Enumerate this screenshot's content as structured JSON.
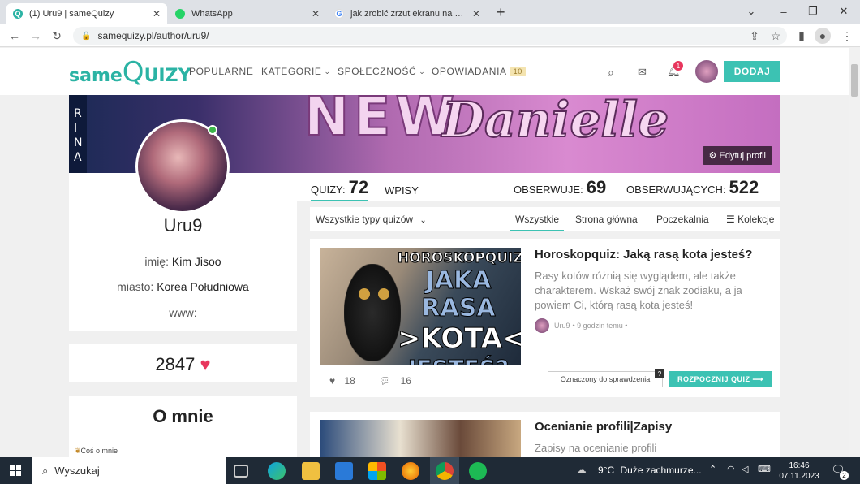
{
  "browser": {
    "tabs": [
      {
        "title": "(1) Uru9 | sameQuizy",
        "active": true,
        "icon": "samequizy-q-icon"
      },
      {
        "title": "WhatsApp",
        "active": false,
        "icon": "whatsapp-icon"
      },
      {
        "title": "jak zrobić zrzut ekranu na komp",
        "active": false,
        "icon": "google-g-icon"
      }
    ],
    "new_tab": "+",
    "url": "samequizy.pl/author/uru9/"
  },
  "site": {
    "logo_same": "same",
    "logo_q": "Q",
    "logo_uizy": "UIZY",
    "nav": [
      "POPULARNE",
      "KATEGORIE",
      "SPOŁECZNOŚĆ",
      "OPOWIADANIA"
    ],
    "opowiadania_badge": "10",
    "notif_count": "1",
    "add_label": "DODAJ"
  },
  "banner": {
    "left_text": "RINA",
    "big_text": "NEW",
    "script_text": "Danielle",
    "edit_label": "Edytuj profil"
  },
  "profile": {
    "username": "Uru9",
    "name_label": "imię:",
    "name_value": "Kim Jisoo",
    "city_label": "miasto:",
    "city_value": "Korea Południowa",
    "www_label": "www:",
    "likes": "2847",
    "about_title": "O mnie",
    "about_snippet": "Coś o mnie"
  },
  "stats": {
    "quizy_label": "QUIZY:",
    "quizy_value": "72",
    "wpisy_label": "WPISY",
    "obserwuje_label": "OBSERWUJE:",
    "obserwuje_value": "69",
    "obserwujacych_label": "OBSERWUJĄCYCH:",
    "obserwujacych_value": "522"
  },
  "filters": {
    "type_select": "Wszystkie typy quizów",
    "tabs": [
      "Wszystkie",
      "Strona główna",
      "Poczekalnia",
      "Kolekcje"
    ],
    "active_tab": "Wszystkie"
  },
  "posts": [
    {
      "thumb_lines": [
        "HOROSKOPQUIZ",
        "JAKA RASA",
        ">KOTA<",
        "JESTEŚ?"
      ],
      "title": "Horoskopquiz: Jaką rasą kota jesteś?",
      "desc": "Rasy kotów różnią się wyglądem, ale także charakterem. Wskaż swój znak zodiaku, a ja powiem Ci, którą rasą kota jesteś!",
      "author": "Uru9",
      "time": "• 9 godzin temu •",
      "likes": "18",
      "comments": "16",
      "review_label": "Oznaczony do sprawdzenia",
      "review_help": "?",
      "start_label": "ROZPOCZNIJ QUIZ ⟶"
    },
    {
      "title": "Ocenianie profili|Zapisy",
      "desc": "Zapisy na ocenianie profili"
    }
  ],
  "taskbar": {
    "search_placeholder": "Wyszukaj",
    "weather_temp": "9°C",
    "weather_desc": "Duże zachmurze...",
    "time": "16:46",
    "date": "07.11.2023",
    "notif_count": "2"
  },
  "colors": {
    "brand": "#2bb3a4",
    "accent": "#3cc2b3",
    "heart": "#e8365d"
  }
}
